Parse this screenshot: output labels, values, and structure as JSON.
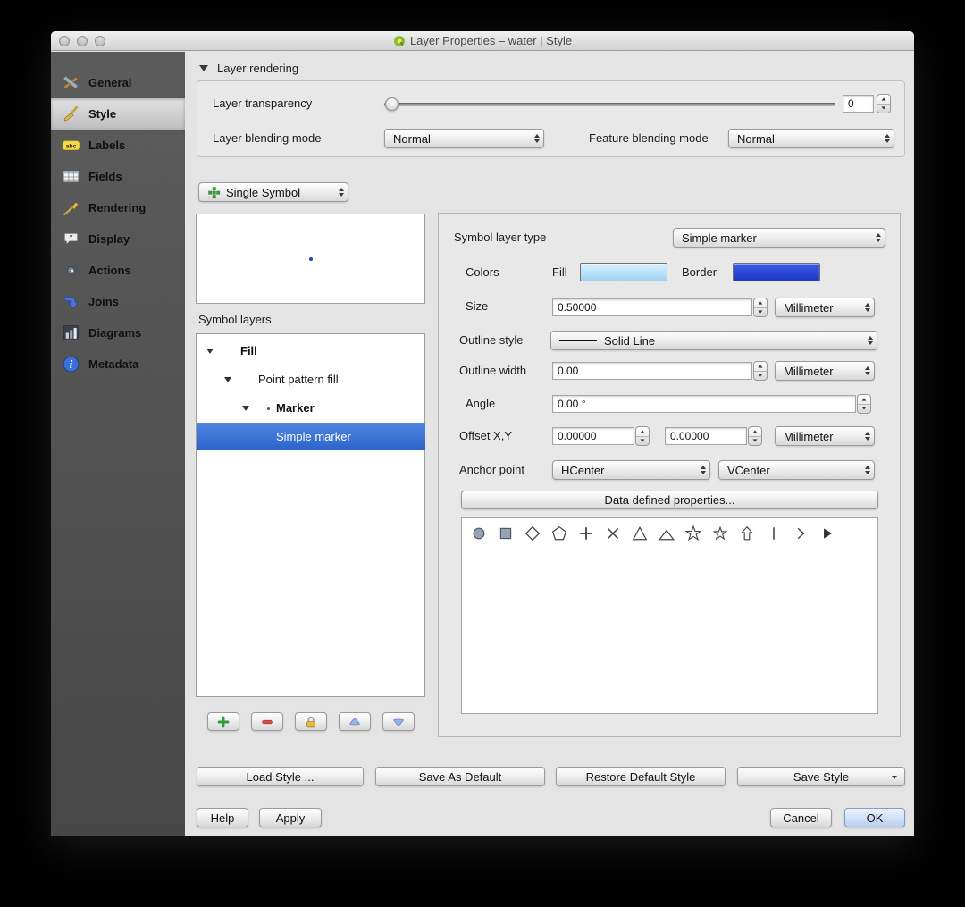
{
  "window": {
    "title": "Layer Properties – water | Style"
  },
  "sidebar": {
    "items": [
      {
        "label": "General"
      },
      {
        "label": "Style"
      },
      {
        "label": "Labels"
      },
      {
        "label": "Fields"
      },
      {
        "label": "Rendering"
      },
      {
        "label": "Display"
      },
      {
        "label": "Actions"
      },
      {
        "label": "Joins"
      },
      {
        "label": "Diagrams"
      },
      {
        "label": "Metadata"
      }
    ]
  },
  "layer_rendering": {
    "title": "Layer rendering",
    "transparency_label": "Layer transparency",
    "transparency_value": "0",
    "blending_label": "Layer blending mode",
    "blending_value": "Normal",
    "feature_blending_label": "Feature blending mode",
    "feature_blending_value": "Normal"
  },
  "renderer": {
    "value": "Single Symbol"
  },
  "symbol_layers": {
    "label": "Symbol layers",
    "tree": [
      {
        "label": "Fill"
      },
      {
        "label": "Point pattern fill"
      },
      {
        "label": "Marker"
      },
      {
        "label": "Simple marker"
      }
    ]
  },
  "props": {
    "type_label": "Symbol layer type",
    "type_value": "Simple marker",
    "colors_label": "Colors",
    "fill_label": "Fill",
    "border_label": "Border",
    "size_label": "Size",
    "size_value": "0.50000",
    "size_unit": "Millimeter",
    "outline_style_label": "Outline style",
    "outline_style_value": "Solid Line",
    "outline_width_label": "Outline width",
    "outline_width_value": "0.00",
    "outline_width_unit": "Millimeter",
    "angle_label": "Angle",
    "angle_value": "0.00 °",
    "offset_label": "Offset X,Y",
    "offset_x": "0.00000",
    "offset_y": "0.00000",
    "offset_unit": "Millimeter",
    "anchor_label": "Anchor point",
    "anchor_h": "HCenter",
    "anchor_v": "VCenter",
    "data_defined": "Data defined properties..."
  },
  "marker_gallery": {
    "icons": [
      "circle",
      "square",
      "diamond",
      "pentagon",
      "plus",
      "cross",
      "triangle",
      "triangle-flat",
      "star",
      "star-outline",
      "arrow-up",
      "vertical-line",
      "chevron-right",
      "arrowhead-right"
    ]
  },
  "style_actions": {
    "load": "Load Style ...",
    "save_default": "Save As Default",
    "restore": "Restore Default Style",
    "save": "Save Style"
  },
  "dialog": {
    "help": "Help",
    "apply": "Apply",
    "cancel": "Cancel",
    "ok": "OK"
  },
  "colors": {
    "fill_swatch": "#aadcf8",
    "border_swatch": "#2244d6",
    "selection": "#3c77d8"
  }
}
